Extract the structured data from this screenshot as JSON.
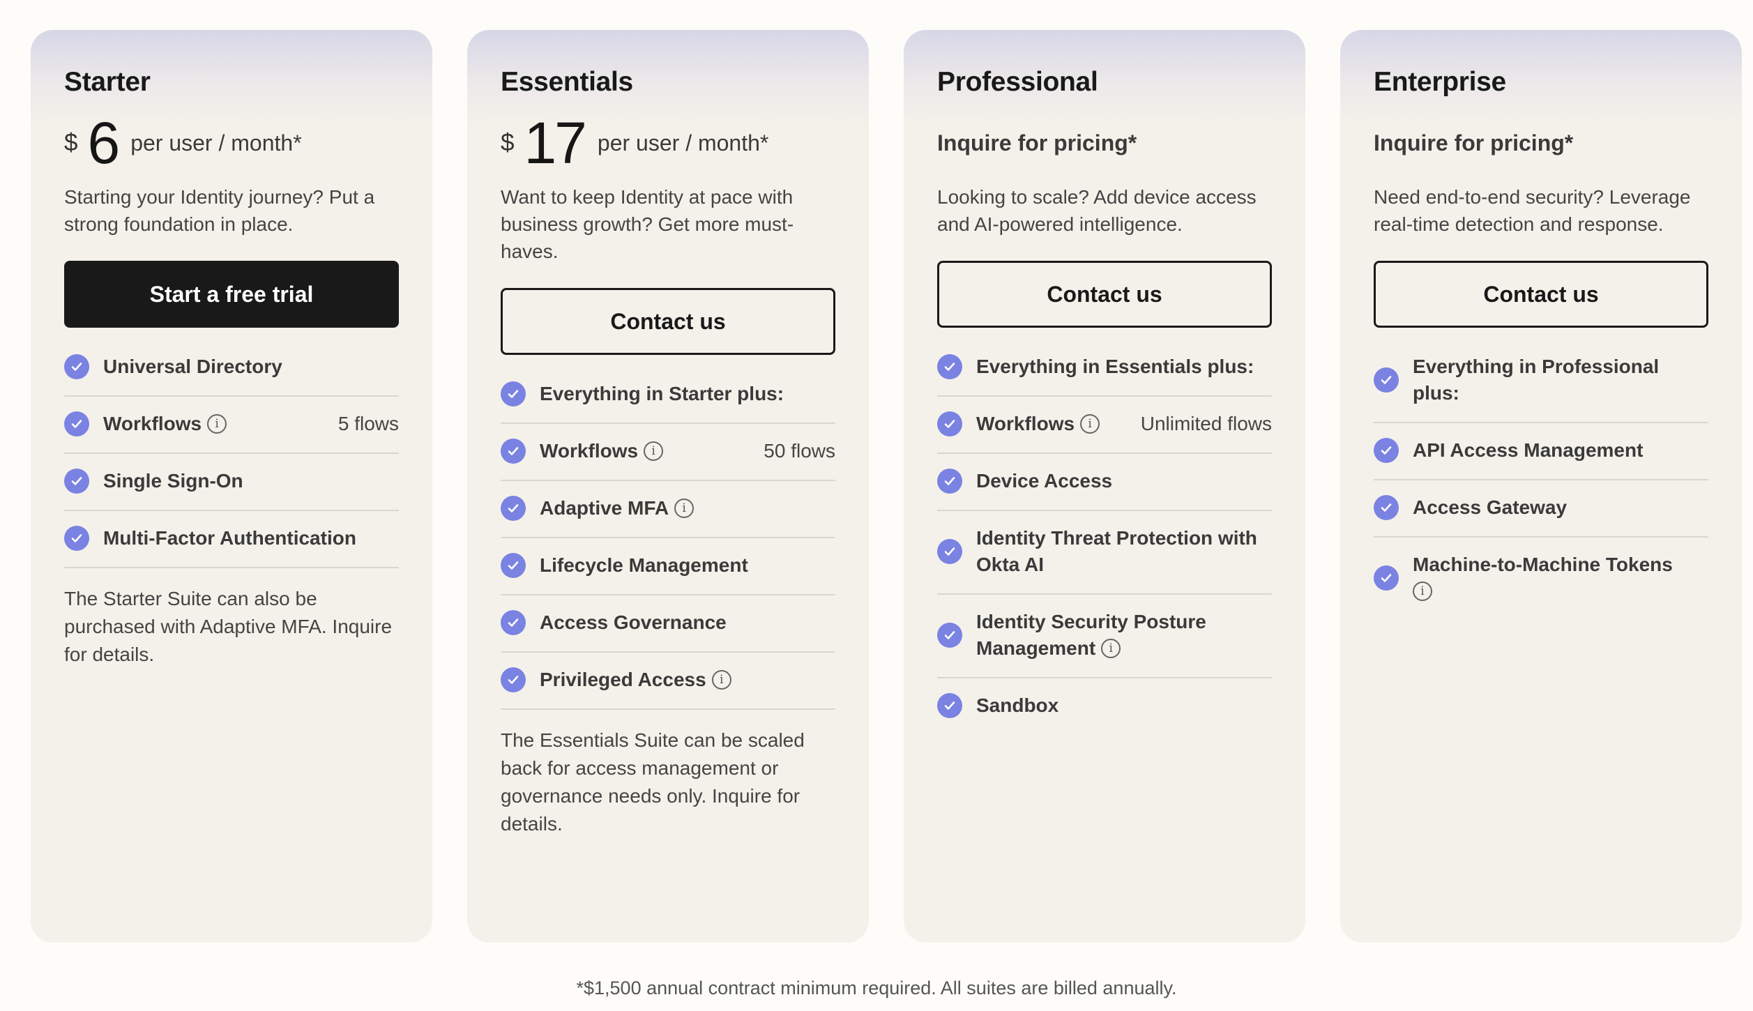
{
  "colors": {
    "accent": "#7a82e2",
    "primary_button": "#191919",
    "card_bg": "#f4f1ea",
    "page_bg": "#fdfcf9"
  },
  "plans": [
    {
      "name": "Starter",
      "price_currency": "$",
      "price_amount": "6",
      "price_unit": "per user / month*",
      "description": "Starting your Identity journey? Put a strong foundation in place.",
      "cta": "Start a free trial",
      "features": [
        {
          "label": "Universal Directory"
        },
        {
          "label": "Workflows",
          "info": true,
          "qty": "5 flows"
        },
        {
          "label": "Single Sign-On"
        },
        {
          "label": "Multi-Factor Authentication"
        }
      ],
      "note": "The Starter Suite can also be purchased with Adaptive MFA. Inquire for details."
    },
    {
      "name": "Essentials",
      "price_currency": "$",
      "price_amount": "17",
      "price_unit": "per user / month*",
      "description": "Want to keep Identity at pace with business growth? Get more must-haves.",
      "cta": "Contact us",
      "features": [
        {
          "label": "Everything in Starter plus:"
        },
        {
          "label": "Workflows",
          "info": true,
          "qty": "50 flows"
        },
        {
          "label": "Adaptive MFA",
          "info": true
        },
        {
          "label": "Lifecycle Management"
        },
        {
          "label": "Access Governance"
        },
        {
          "label": "Privileged Access",
          "info": true
        }
      ],
      "note": "The Essentials Suite can be scaled back for access management or governance needs only. Inquire for details."
    },
    {
      "name": "Professional",
      "price_text": "Inquire for pricing*",
      "description": "Looking to scale? Add device access and AI-powered intelligence.",
      "cta": "Contact us",
      "features": [
        {
          "label": "Everything in Essentials plus:"
        },
        {
          "label": "Workflows",
          "info": true,
          "qty": "Unlimited flows"
        },
        {
          "label": "Device Access"
        },
        {
          "label": "Identity Threat Protection with Okta AI"
        },
        {
          "label": "Identity Security Posture Management",
          "info": true
        },
        {
          "label": "Sandbox"
        }
      ]
    },
    {
      "name": "Enterprise",
      "price_text": "Inquire for pricing*",
      "description": "Need end-to-end security? Leverage real-time detection and response.",
      "cta": "Contact us",
      "features": [
        {
          "label": "Everything in Professional plus:"
        },
        {
          "label": "API Access Management"
        },
        {
          "label": "Access Gateway"
        },
        {
          "label": "Machine-to-Machine Tokens",
          "info": true
        }
      ]
    }
  ],
  "footnote": "*$1,500 annual contract minimum required. All suites are billed annually."
}
